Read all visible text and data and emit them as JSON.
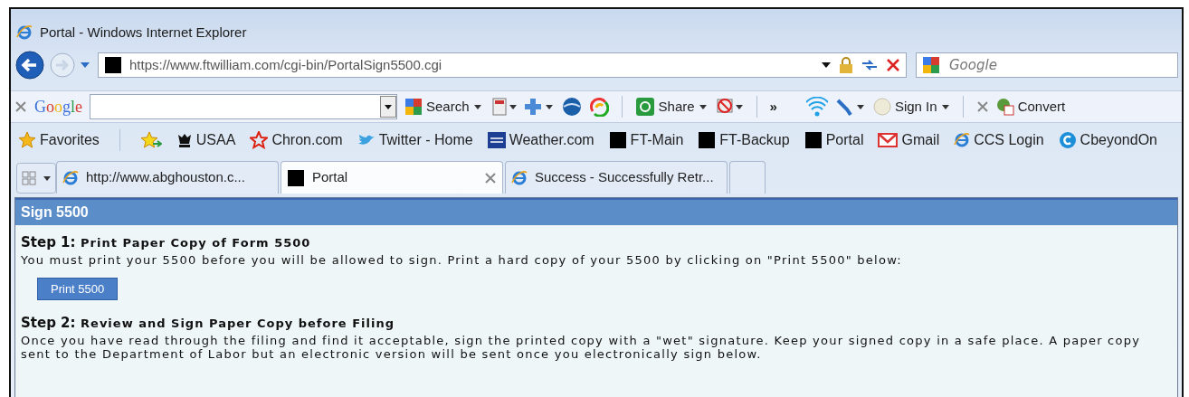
{
  "window": {
    "title": "Portal - Windows Internet Explorer"
  },
  "address_bar": {
    "url": "https://www.ftwilliam.com/cgi-bin/PortalSign5500.cgi"
  },
  "search_box": {
    "placeholder": "Google"
  },
  "google_toolbar": {
    "logo": "Google",
    "items": [
      {
        "kind": "menu",
        "label": "Search"
      },
      {
        "kind": "menu",
        "label": "Share"
      },
      {
        "kind": "chevron",
        "label": "»"
      },
      {
        "kind": "menu",
        "label": "Sign In"
      },
      {
        "kind": "link",
        "label": "Convert"
      }
    ]
  },
  "favorites": {
    "label": "Favorites",
    "links": [
      {
        "label": "USAA",
        "kind": "usaa"
      },
      {
        "label": "Chron.com",
        "kind": "star"
      },
      {
        "label": "Twitter - Home",
        "kind": "bird"
      },
      {
        "label": "Weather.com",
        "kind": "twc"
      },
      {
        "label": "FT-Main",
        "kind": "square"
      },
      {
        "label": "FT-Backup",
        "kind": "square"
      },
      {
        "label": "Portal",
        "kind": "square"
      },
      {
        "label": "Gmail",
        "kind": "mail"
      },
      {
        "label": "CCS Login",
        "kind": "ie"
      },
      {
        "label": "CbeyondOn",
        "kind": "cbeyond"
      }
    ]
  },
  "tabs": [
    {
      "label": "http://www.abghouston.c...",
      "kind": "ie",
      "selected": false
    },
    {
      "label": "Portal",
      "kind": "square",
      "selected": true
    },
    {
      "label": "Success - Successfully Retr...",
      "kind": "ie",
      "selected": false
    }
  ],
  "page": {
    "header": "Sign 5500",
    "steps": [
      {
        "number": "Step 1:",
        "title": "Print Paper Copy of Form 5500",
        "lines": [
          "You must print your 5500 before you will be allowed to sign. Print a hard copy of your 5500 by clicking on \"Print 5500\" below:"
        ],
        "button": "Print 5500"
      },
      {
        "number": "Step 2:",
        "title": "Review and Sign Paper Copy before Filing",
        "lines": [
          "Once you have read through the filing and find it acceptable, sign the printed copy with a \"wet\" signature. Keep your signed copy in a safe place. A paper copy",
          "sent to the Department of Labor but an electronic version will be sent once you electronically sign below."
        ]
      }
    ]
  }
}
